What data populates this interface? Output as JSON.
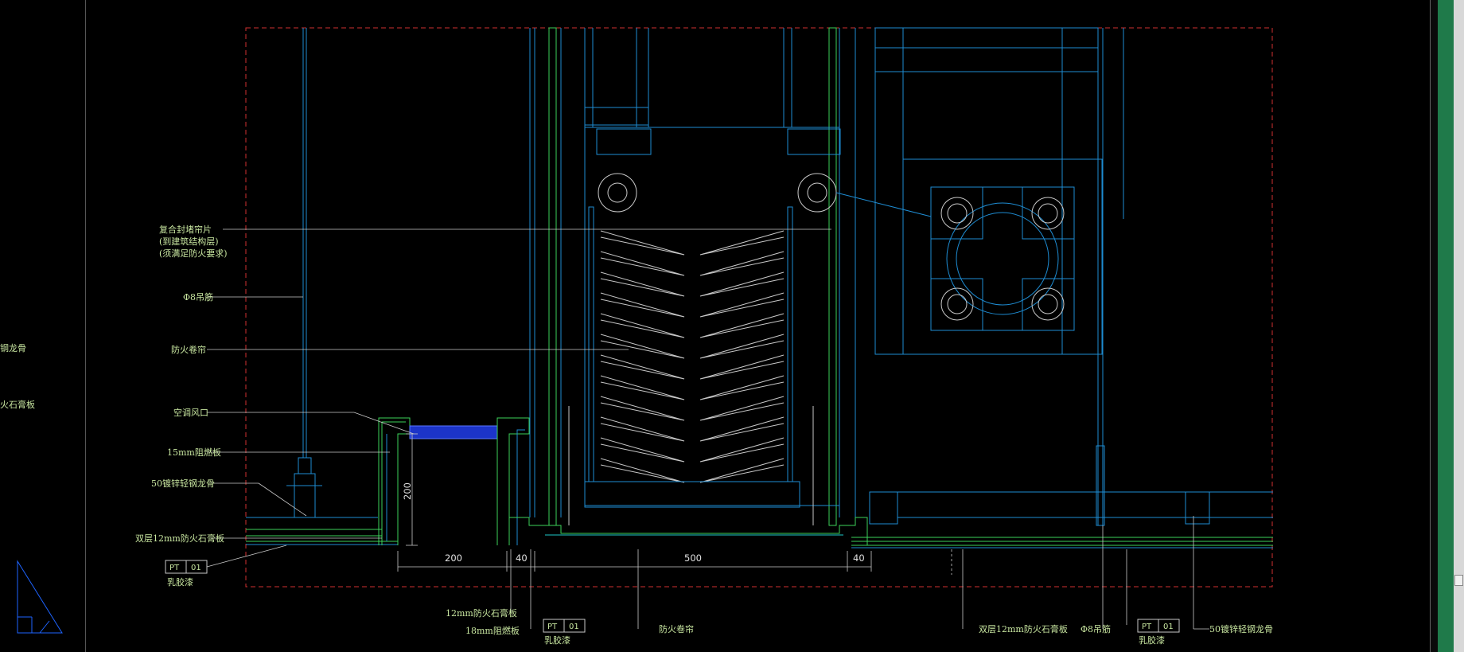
{
  "drawing": {
    "annotations": {
      "composite_partition": [
        "复合封堵帘片",
        "(到建筑结构层)",
        "(须满足防火要求)"
      ],
      "hanger_rod_left": "Φ8吊筋",
      "fire_shutter_upper": "防火卷帘",
      "ac_vent": "空调风口",
      "plywood_15": "15mm阻燃板",
      "keel_50_left": "50镀锌轻钢龙骨",
      "gypsum_double_left": "双层12mm防火石膏板",
      "gypsum_12_bottom": "12mm防火石膏板",
      "plywood_18_bottom": "18mm阻燃板",
      "fire_shutter_bottom": "防火卷帘",
      "gypsum_double_right": "双层12mm防火石膏板",
      "hanger_rod_right": "Φ8吊筋",
      "keel_50_right": "50镀锌轻钢龙骨",
      "cut_keel": "钢龙骨",
      "cut_gypsum": "火石膏板"
    },
    "finish_tags": [
      {
        "code": "PT",
        "number": "01",
        "name": "乳胶漆"
      },
      {
        "code": "PT",
        "number": "01",
        "name": "乳胶漆"
      },
      {
        "code": "PT",
        "number": "01",
        "name": "乳胶漆"
      }
    ],
    "dimensions": {
      "d200_horizontal": "200",
      "d40_a": "40",
      "d500": "500",
      "d40_b": "40",
      "d200_vertical": "200"
    }
  },
  "colors": {
    "background": "#000000",
    "frame": "#d03030",
    "structure": "#1e8cd2",
    "finish": "#3cd25a",
    "text": "#c8e6a0",
    "panel": "#1f7a4a"
  }
}
